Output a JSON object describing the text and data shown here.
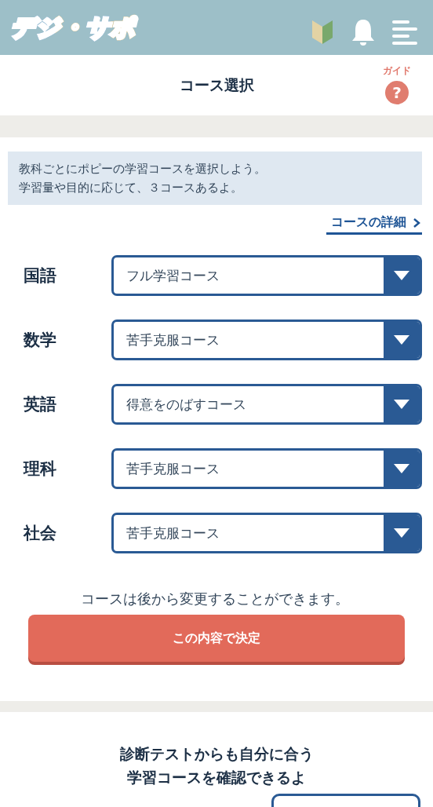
{
  "header": {
    "logo": "デジ・サポ"
  },
  "title_bar": {
    "title": "コース選択",
    "guide_label": "ガイド",
    "guide_icon": "?"
  },
  "intro": {
    "lines": [
      "教科ごとにポピーの学習コースを選択しよう。",
      "学習量や目的に応じて、３コースあるよ。"
    ],
    "detail_link": "コースの詳細"
  },
  "subjects": [
    {
      "label": "国語",
      "course": "フル学習コース"
    },
    {
      "label": "数学",
      "course": "苦手克服コース"
    },
    {
      "label": "英語",
      "course": "得意をのばすコース"
    },
    {
      "label": "理科",
      "course": "苦手克服コース"
    },
    {
      "label": "社会",
      "course": "苦手克服コース"
    }
  ],
  "note": "コースは後から変更することができます。",
  "submit_button": "この内容で決定",
  "diagnosis": {
    "heading_lines": [
      "診断テストからも自分に合う",
      "学習コースを確認できるよ"
    ]
  }
}
